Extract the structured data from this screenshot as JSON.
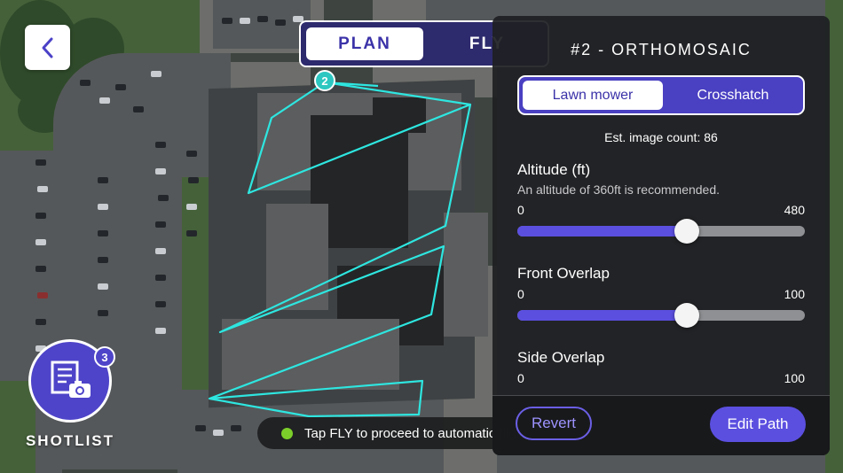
{
  "header": {
    "back_icon": "chevron-left-icon",
    "modes": {
      "plan": "PLAN",
      "fly": "FLY"
    }
  },
  "map": {
    "waypoint_label": "2",
    "path_color": "#2ee6e0"
  },
  "shotlist": {
    "label": "SHOTLIST",
    "badge_count": "3",
    "icon": "shotlist-camera-icon"
  },
  "toast": {
    "text": "Tap FLY to proceed to automatic flight",
    "status_color": "#7ccf2a"
  },
  "panel": {
    "title": "#2 - ORTHOMOSAIC",
    "patterns": {
      "lawn": "Lawn mower",
      "cross": "Crosshatch",
      "selected": "Lawn mower"
    },
    "est_count": "Est. image count: 86",
    "altitude": {
      "label": "Altitude (ft)",
      "hint": "An altitude of 360ft is recommended.",
      "min": "0",
      "max": "480",
      "level": 0.59
    },
    "front_overlap": {
      "label": "Front Overlap",
      "min": "0",
      "max": "100",
      "level": 0.59
    },
    "side_overlap": {
      "label": "Side Overlap",
      "min": "0",
      "max": "100"
    },
    "revert_label": "Revert",
    "edit_label": "Edit Path"
  },
  "colors": {
    "accent": "#5b4fe0",
    "toggle_bg": "#2e2a6e"
  }
}
